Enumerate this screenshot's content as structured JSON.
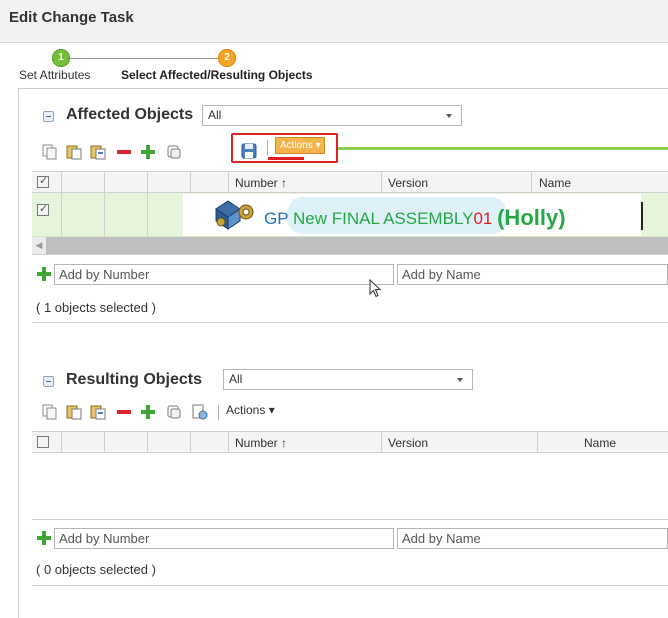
{
  "title": "Edit Change Task",
  "wizard": {
    "steps": [
      {
        "number": "1",
        "label": "Set Attributes",
        "state": "complete",
        "color": "#75bf3b"
      },
      {
        "number": "2",
        "label": "Select Affected/Resulting Objects",
        "state": "current",
        "color": "#f6a623"
      }
    ]
  },
  "affected": {
    "title": "Affected Objects",
    "filter_value": "All",
    "actions_label": "Actions",
    "columns": [
      "Number",
      "Version",
      "Name"
    ],
    "sort_indicator": "↑",
    "rows": [
      {
        "selected": true,
        "icon": "assembly-part-icon",
        "number_prefix": "GP",
        "number_middle": "New FINAL ASSEMBLY",
        "number_suffix": "01",
        "owner": "(Holly)"
      }
    ],
    "add_by_number_placeholder": "Add by Number",
    "add_by_name_placeholder": "Add by Name",
    "status": "( 1 objects selected )"
  },
  "resulting": {
    "title": "Resulting Objects",
    "filter_value": "All",
    "actions_label": "Actions",
    "columns": [
      "Number",
      "Version",
      "Name"
    ],
    "sort_indicator": "↑",
    "rows": [],
    "add_by_number_placeholder": "Add by Number",
    "add_by_name_placeholder": "Add by Name",
    "status": "( 0 objects selected )"
  },
  "colors": {
    "highlight_box": "#e02020",
    "annotation_line": "#8fcf4f",
    "row_selected_bg": "#e7f4dc",
    "callout_blue": "#1f73c4",
    "callout_green": "#27a745",
    "callout_red": "#e02020"
  }
}
